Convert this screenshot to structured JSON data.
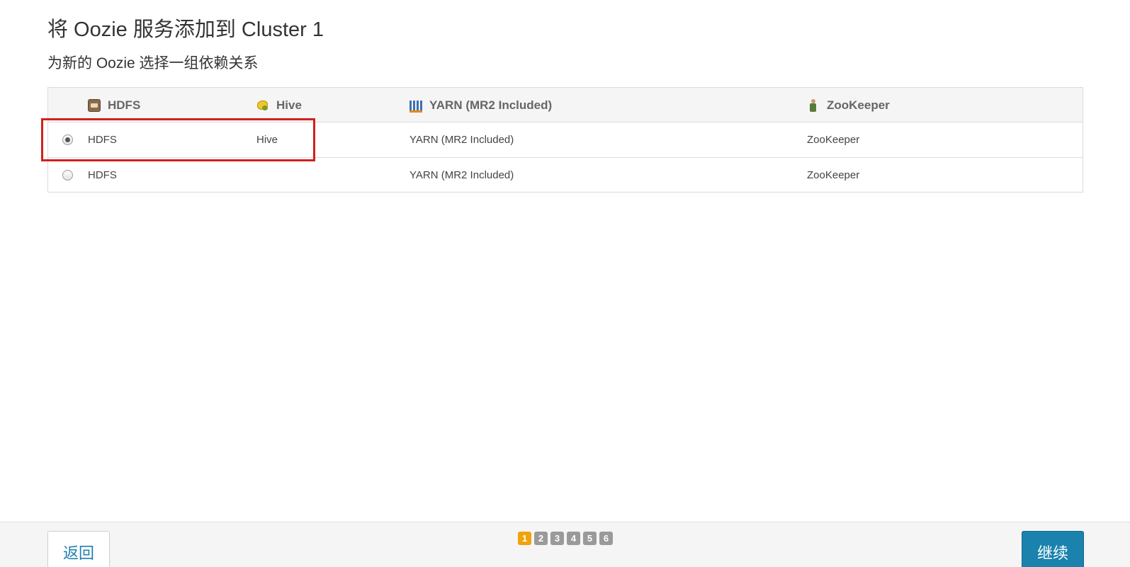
{
  "page": {
    "title": "将 Oozie 服务添加到 Cluster 1",
    "subtitle": "为新的 Oozie 选择一组依赖关系"
  },
  "table": {
    "columns": [
      {
        "label": "HDFS",
        "icon": "hdfs-icon"
      },
      {
        "label": "Hive",
        "icon": "hive-icon"
      },
      {
        "label": "YARN (MR2 Included)",
        "icon": "yarn-icon"
      },
      {
        "label": "ZooKeeper",
        "icon": "zookeeper-icon"
      }
    ],
    "rows": [
      {
        "selected": true,
        "hdfs": "HDFS",
        "hive": "Hive",
        "yarn": "YARN (MR2 Included)",
        "zookeeper": "ZooKeeper"
      },
      {
        "selected": false,
        "hdfs": "HDFS",
        "hive": "",
        "yarn": "YARN (MR2 Included)",
        "zookeeper": "ZooKeeper"
      }
    ]
  },
  "annotation": {
    "color": "#d0201f"
  },
  "footer": {
    "back_label": "返回",
    "continue_label": "继续",
    "steps": [
      "1",
      "2",
      "3",
      "4",
      "5",
      "6"
    ],
    "current_step": "1"
  },
  "colors": {
    "accent": "#1a82ad",
    "step_active": "#f0a30a",
    "step_inactive": "#9a9a9a"
  }
}
